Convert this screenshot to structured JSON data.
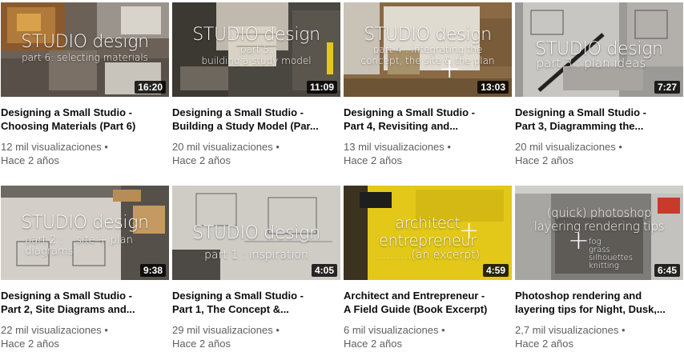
{
  "videos": [
    {
      "overlay_title": "STUDIO design",
      "overlay_sub": "part 6: selecting materials",
      "duration": "16:20",
      "title": "Designing a Small Studio -\nChoosing Materials (Part 6)",
      "views": "12 mil visualizaciones",
      "age": "Hace 2 años"
    },
    {
      "overlay_title": "STUDIO design",
      "overlay_sub": "part 5:\nbuilding a study model",
      "duration": "11:09",
      "title": "Designing a Small Studio -\nBuilding a Study Model (Par...",
      "views": "20 mil visualizaciones",
      "age": "Hace 2 años"
    },
    {
      "overlay_title": "STUDIO design",
      "overlay_sub": "part 4 : integrating the\nconcept, the site & the plan",
      "duration": "13:03",
      "title": "Designing a Small Studio -\nPart 4, Revisiting and...",
      "views": "13 mil visualizaciones",
      "age": "Hace 2 años"
    },
    {
      "overlay_title": "STUDIO design",
      "overlay_sub": "part 3 : plan ideas",
      "duration": "7:27",
      "title": "Designing a Small Studio -\nPart 3, Diagramming the...",
      "views": "20 mil visualizaciones",
      "age": "Hace 2 años"
    },
    {
      "overlay_title": "STUDIO design",
      "overlay_sub": "part 2 :    site + plan\ndiagrams",
      "duration": "9:38",
      "title": "Designing a Small Studio -\nPart 2, Site Diagrams and...",
      "views": "22 mil visualizaciones",
      "age": "Hace 2 años"
    },
    {
      "overlay_title": "STUDIO design",
      "overlay_sub": "part 1 : inspiration",
      "duration": "4:05",
      "title": "Designing a Small Studio -\nPart 1, The Concept &...",
      "views": "29 mil visualizaciones",
      "age": "Hace 2 años"
    },
    {
      "overlay_title": "architect\nentrepreneur",
      "overlay_sub": "..........(an excerpt)",
      "duration": "4:59",
      "title": "Architect and Entrepreneur -\nA Field Guide (Book Excerpt)",
      "views": "6 mil visualizaciones",
      "age": "Hace 2 años"
    },
    {
      "overlay_title": "(quick) photoshop\nlayering rendering tips",
      "overlay_sub": "fog\ngrass\nsilhouettes\nknitting",
      "duration": "6:45",
      "title": "Photoshop rendering and\nlayering tips for Night, Dusk,...",
      "views": "2,7 mil visualizaciones",
      "age": "Hace 2 años"
    }
  ],
  "separator": "•",
  "colors": {
    "title": "#0d0d0d",
    "meta": "#606060",
    "duration_bg": "#000000",
    "book_yellow": "#e3c81a"
  }
}
